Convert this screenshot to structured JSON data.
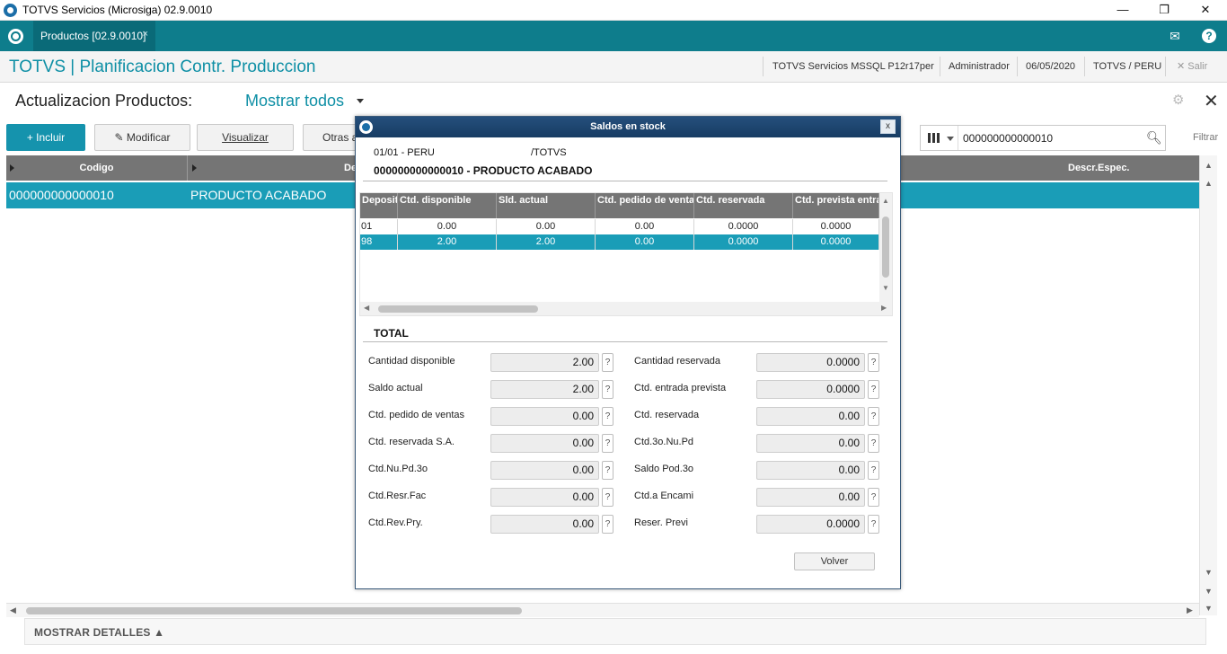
{
  "window": {
    "title": "TOTVS Servicios (Microsiga) 02.9.0010",
    "minimize": "—",
    "restore": "❐",
    "close": "✕"
  },
  "tabstrip": {
    "tab_label": "Productos [02.9.0010]",
    "tab_close": "×",
    "mail_icon": "✉",
    "help_icon": "?"
  },
  "module": {
    "title": "TOTVS | Planificacion Contr. Produccion",
    "environment": "TOTVS Servicios MSSQL P12r17per",
    "user": "Administrador",
    "date": "06/05/2020",
    "company": "TOTVS / PERU",
    "exit_label": "✕  Salir"
  },
  "page": {
    "title": "Actualizacion Productos:",
    "filter": "Mostrar todos"
  },
  "toolbar": {
    "include": "+ Incluir",
    "modify": "✎ Modificar",
    "view": "Visualizar",
    "others": "Otras a",
    "search_value": "000000000000010",
    "filter_label": "Filtrar"
  },
  "grid": {
    "columns": [
      "Codigo",
      "De",
      "Descr.Espec."
    ],
    "rows": [
      {
        "codigo": "000000000000010",
        "descripcion": "PRODUCTO ACABADO"
      }
    ]
  },
  "details": {
    "label": "MOSTRAR DETALLES ▲"
  },
  "dialog": {
    "title": "Saldos en stock",
    "close": "x",
    "branch": "01/01 - PERU",
    "company": "/TOTVS",
    "product": "000000000000010 - PRODUCTO ACABADO",
    "table": {
      "columns": [
        "Deposito",
        "Ctd. disponible",
        "Sld. actual",
        "Ctd. pedido de ventas",
        "Ctd. reservada",
        "Ctd. prevista entrada"
      ],
      "rows": [
        [
          "01",
          "0.00",
          "0.00",
          "0.00",
          "0.0000",
          "0.0000"
        ],
        [
          "98",
          "2.00",
          "2.00",
          "0.00",
          "0.0000",
          "0.0000"
        ]
      ]
    },
    "total_label": "TOTAL",
    "totals_left": [
      {
        "label": "Cantidad disponible",
        "value": "2.00"
      },
      {
        "label": "Saldo actual",
        "value": "2.00"
      },
      {
        "label": "Ctd. pedido de ventas",
        "value": "0.00"
      },
      {
        "label": "Ctd. reservada S.A.",
        "value": "0.00"
      },
      {
        "label": "Ctd.Nu.Pd.3o",
        "value": "0.00"
      },
      {
        "label": "Ctd.Resr.Fac",
        "value": "0.00"
      },
      {
        "label": "Ctd.Rev.Pry.",
        "value": "0.00"
      }
    ],
    "totals_right": [
      {
        "label": "Cantidad reservada",
        "value": "0.0000"
      },
      {
        "label": "Ctd. entrada prevista",
        "value": "0.0000"
      },
      {
        "label": "Ctd. reservada",
        "value": "0.00"
      },
      {
        "label": "Ctd.3o.Nu.Pd",
        "value": "0.00"
      },
      {
        "label": "Saldo Pod.3o",
        "value": "0.00"
      },
      {
        "label": "Ctd.a Encami",
        "value": "0.00"
      },
      {
        "label": "Reser. Previ",
        "value": "0.0000"
      }
    ],
    "help_glyph": "?",
    "back_button": "Volver"
  },
  "colors": {
    "teal": "#0e7d8c",
    "selection": "#1a9db7",
    "header_gray": "#757575",
    "dialog_title": "#1e4670"
  }
}
